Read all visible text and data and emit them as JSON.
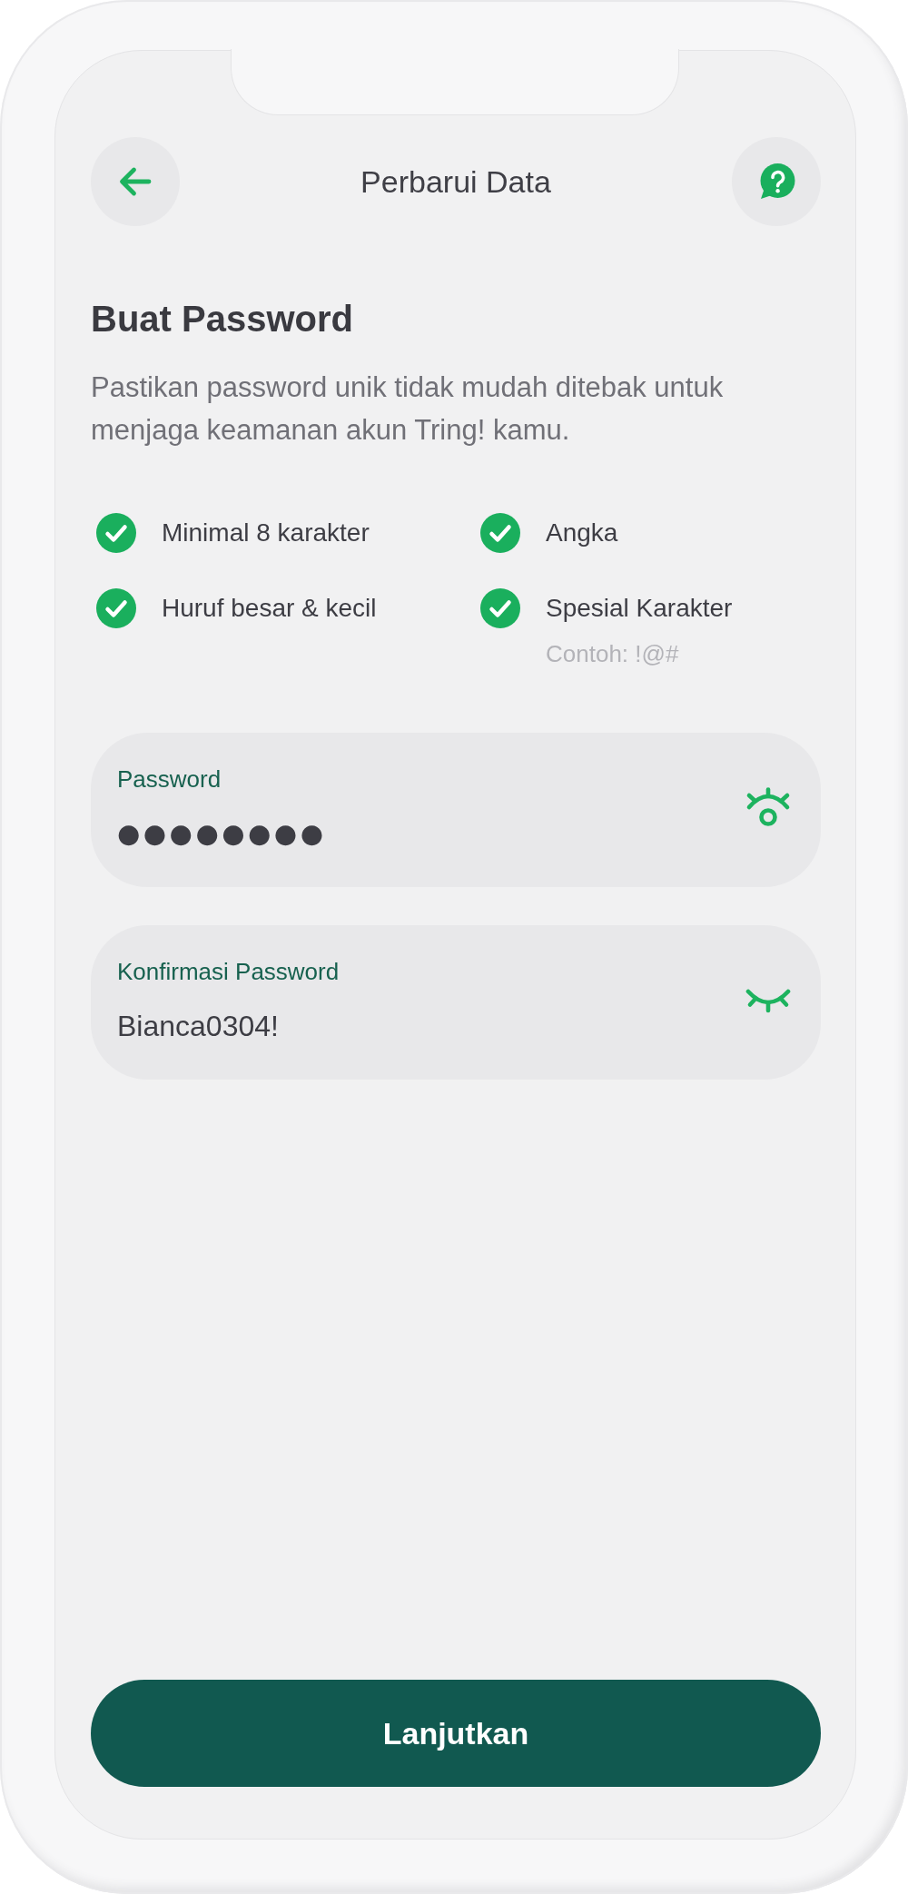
{
  "header": {
    "title": "Perbarui Data"
  },
  "heading": "Buat Password",
  "description": "Pastikan password unik tidak mudah ditebak untuk menjaga keamanan akun Tring! kamu.",
  "requirements": [
    {
      "label": "Minimal 8 karakter",
      "checked": true
    },
    {
      "label": "Angka",
      "checked": true
    },
    {
      "label": "Huruf besar & kecil",
      "checked": true
    },
    {
      "label": "Spesial Karakter",
      "hint": "Contoh: !@#",
      "checked": true
    }
  ],
  "fields": [
    {
      "label": "Password",
      "value": "●●●●●●●●",
      "masked": true
    },
    {
      "label": "Konfirmasi Password",
      "value": "Bianca0304!",
      "masked": false
    }
  ],
  "submit_button": {
    "label": "Lanjutkan"
  }
}
